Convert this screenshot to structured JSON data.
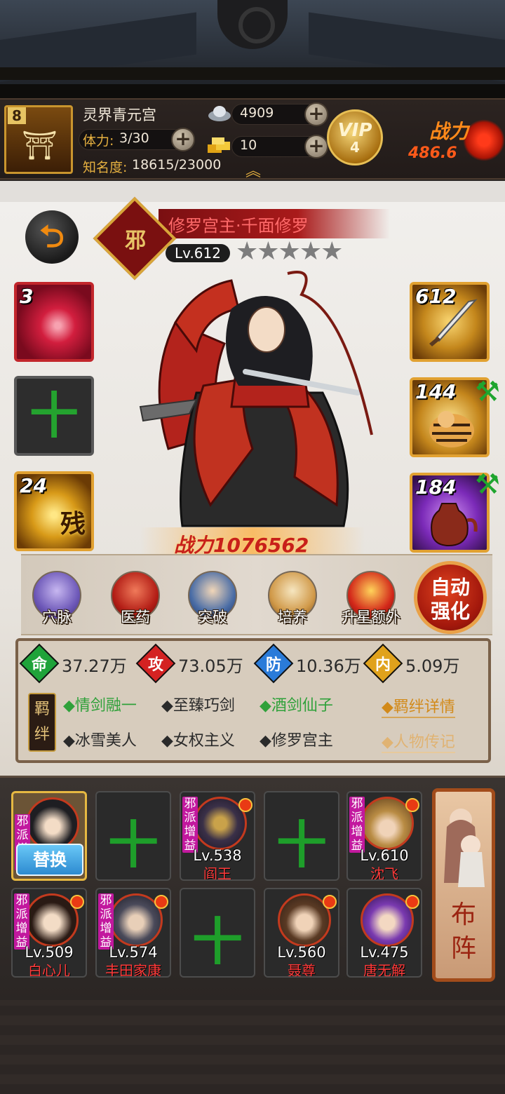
{
  "player": {
    "level": "8",
    "name": "灵界青元宫",
    "stamina_label": "体力:",
    "stamina_value": "3/30",
    "fame_label": "知名度:",
    "fame_value": "18615/23000",
    "silver": "4909",
    "gold": "10",
    "vip_label": "VIP",
    "vip_level": "4",
    "power_label": "战力",
    "power_value": "486.6"
  },
  "hero": {
    "faction": "邪",
    "title": "修罗宫主·千面修罗",
    "level": "Lv.612",
    "stars": "★★★★★",
    "power": "战力1076562"
  },
  "equipment": {
    "left": [
      {
        "count": "3"
      },
      {
        "count": ""
      },
      {
        "count": "24",
        "text": "残"
      }
    ],
    "right": [
      {
        "count": "612"
      },
      {
        "count": "144"
      },
      {
        "count": "184"
      }
    ]
  },
  "functions": [
    "穴脉",
    "医药",
    "突破",
    "培养",
    "升星额外"
  ],
  "auto_button": [
    "自动",
    "强化"
  ],
  "stats": [
    {
      "icon": "命",
      "value": "37.27万",
      "color": "#1fa33a"
    },
    {
      "icon": "攻",
      "value": "73.05万",
      "color": "#d42222"
    },
    {
      "icon": "防",
      "value": "10.36万",
      "color": "#2a7bd9"
    },
    {
      "icon": "内",
      "value": "5.09万",
      "color": "#e0a21c"
    }
  ],
  "bonds": {
    "badge": [
      "羁",
      "绊"
    ],
    "row1": [
      {
        "text": "◆情剑融一",
        "active": true
      },
      {
        "text": "◆至臻巧剑",
        "active": false
      },
      {
        "text": "◆酒剑仙子",
        "active": true
      }
    ],
    "row2": [
      {
        "text": "◆冰雪美人",
        "active": false
      },
      {
        "text": "◆女权主义",
        "active": false
      },
      {
        "text": "◆修罗宫主",
        "active": false
      }
    ],
    "detail_link": "◆羁绊详情",
    "bio_link": "◆人物传记"
  },
  "lineup": {
    "tag": "邪派增益",
    "swap_label": "替换",
    "formation_label": [
      "布",
      "阵"
    ],
    "plus": "十",
    "row1": [
      {
        "type": "selected"
      },
      {
        "type": "empty"
      },
      {
        "type": "hero",
        "level": "Lv.538",
        "name": "阎王"
      },
      {
        "type": "empty"
      },
      {
        "type": "hero",
        "level": "Lv.610",
        "name": "沈飞"
      }
    ],
    "row2": [
      {
        "type": "hero",
        "level": "Lv.509",
        "name": "白心儿"
      },
      {
        "type": "hero",
        "level": "Lv.574",
        "name": "丰田家康"
      },
      {
        "type": "empty"
      },
      {
        "type": "hero",
        "level": "Lv.560",
        "name": "聂尊",
        "notag": true
      },
      {
        "type": "hero",
        "level": "Lv.475",
        "name": "唐无解",
        "notag": true
      }
    ]
  }
}
